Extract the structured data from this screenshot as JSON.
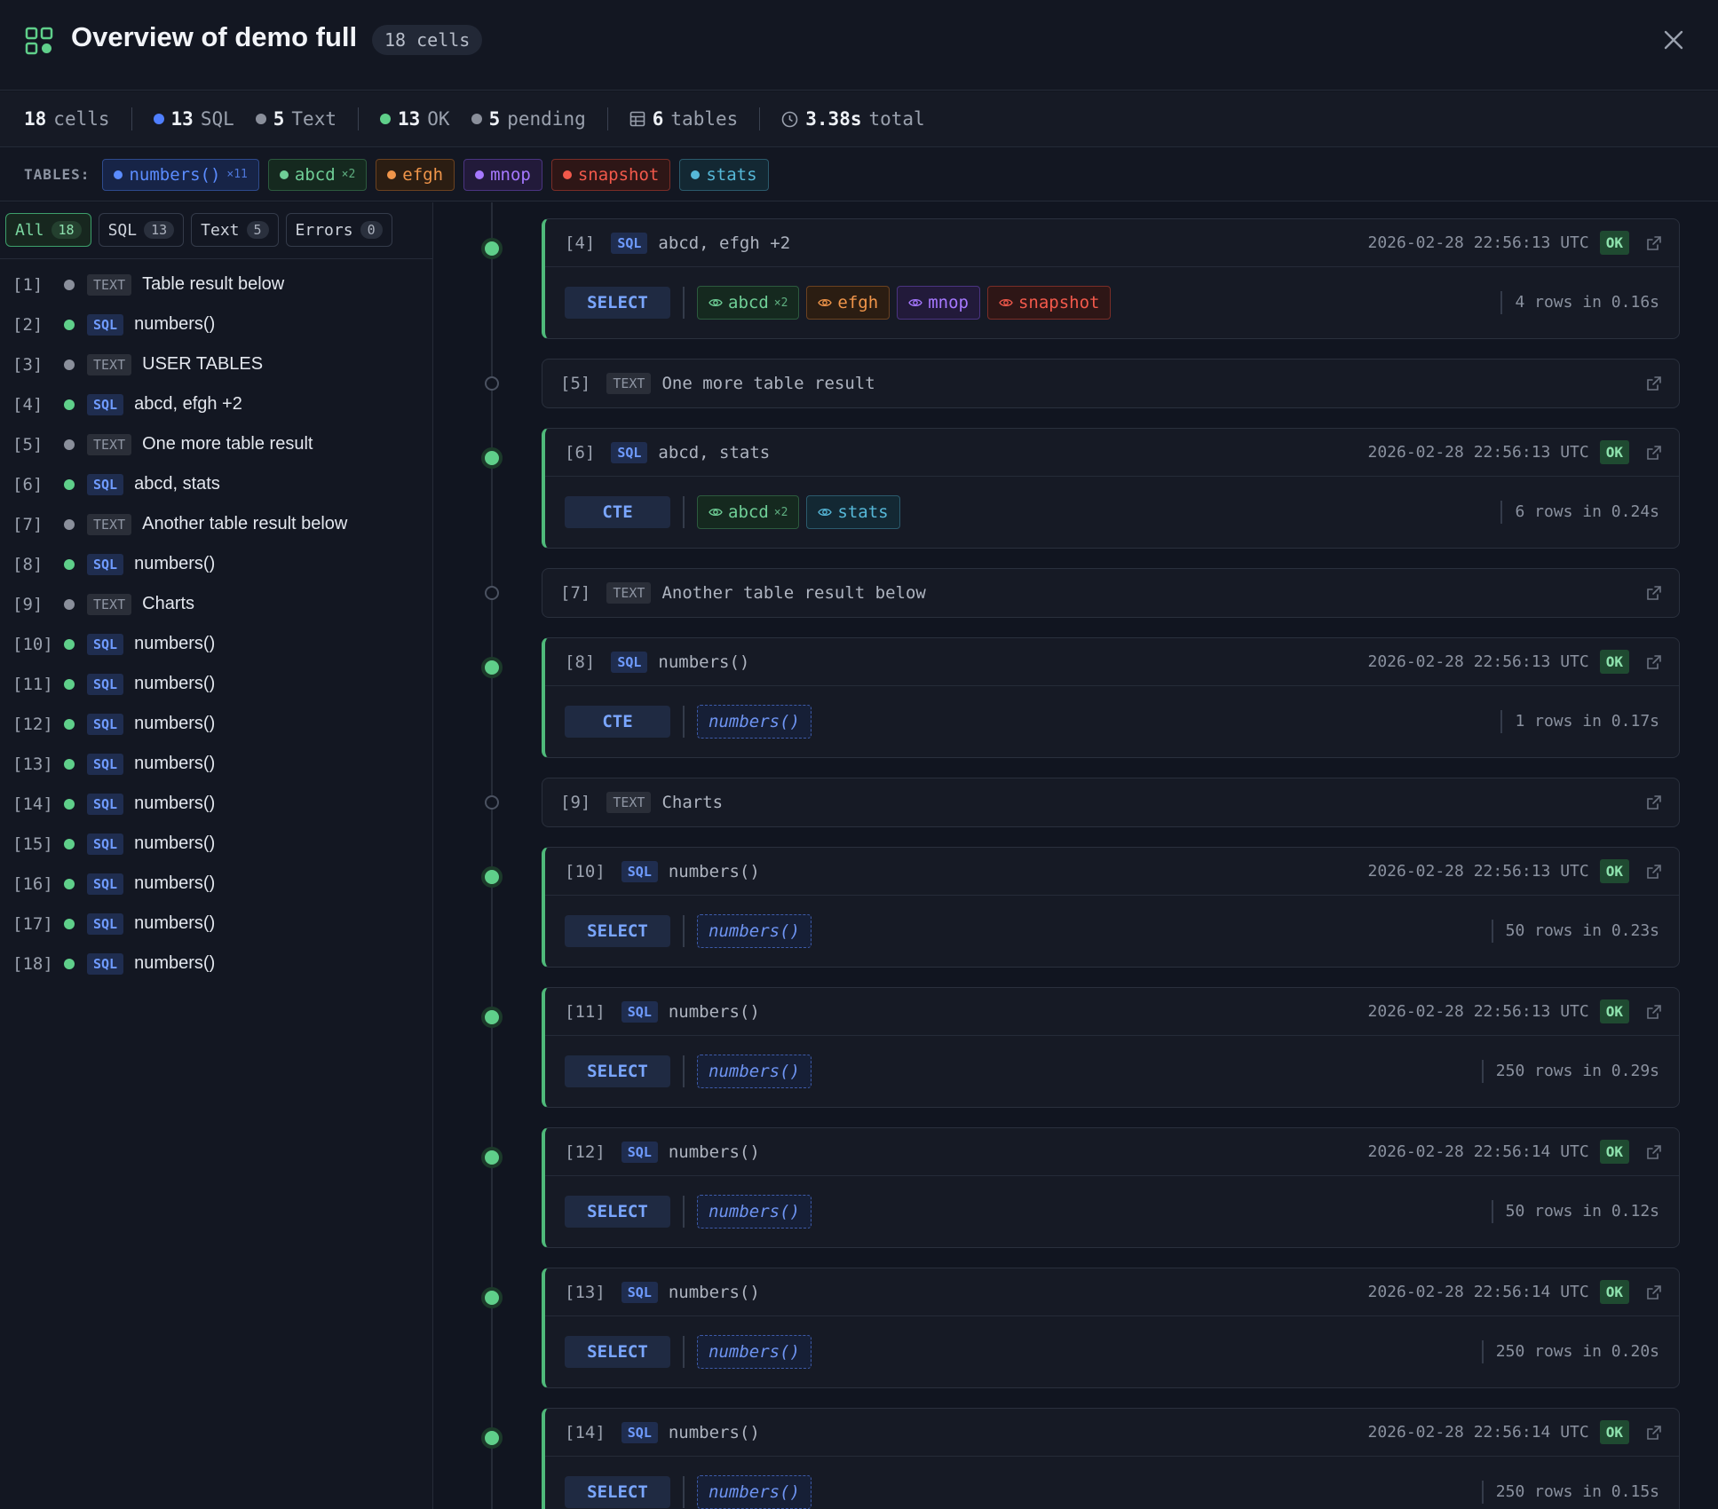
{
  "header": {
    "title": "Overview of demo full",
    "cells_pill": "18 cells"
  },
  "stats": {
    "cells_n": "18",
    "cells_lbl": "cells",
    "sql_n": "13",
    "sql_lbl": "SQL",
    "text_n": "5",
    "text_lbl": "Text",
    "ok_n": "13",
    "ok_lbl": "OK",
    "pending_n": "5",
    "pending_lbl": "pending",
    "tables_n": "6",
    "tables_lbl": "tables",
    "total_n": "3.38s",
    "total_lbl": "total"
  },
  "tables_label": "TABLES:",
  "tables": [
    {
      "name": "numbers()",
      "count": "×11",
      "color": "#5b8cff",
      "bg": "#172447",
      "border": "#2e4a8c"
    },
    {
      "name": "abcd",
      "count": "×2",
      "color": "#6fcf97",
      "bg": "#15291f",
      "border": "#2c5a3e"
    },
    {
      "name": "efgh",
      "count": "",
      "color": "#f0954a",
      "bg": "#2b1d12",
      "border": "#6b4220"
    },
    {
      "name": "mnop",
      "count": "",
      "color": "#a678ff",
      "bg": "#221a3a",
      "border": "#4a3480"
    },
    {
      "name": "snapshot",
      "count": "",
      "color": "#f2594b",
      "bg": "#2e1616",
      "border": "#7a2d27"
    },
    {
      "name": "stats",
      "count": "",
      "color": "#56b8d8",
      "bg": "#132833",
      "border": "#2b5a6c"
    }
  ],
  "filter_tabs": [
    {
      "label": "All",
      "n": "18"
    },
    {
      "label": "SQL",
      "n": "13"
    },
    {
      "label": "Text",
      "n": "5"
    },
    {
      "label": "Errors",
      "n": "0"
    }
  ],
  "sidebar_items": [
    {
      "idx": "[1]",
      "type": "TEXT",
      "name": "Table result below"
    },
    {
      "idx": "[2]",
      "type": "SQL",
      "name": "numbers()"
    },
    {
      "idx": "[3]",
      "type": "TEXT",
      "name": "USER TABLES"
    },
    {
      "idx": "[4]",
      "type": "SQL",
      "name": "abcd, efgh +2"
    },
    {
      "idx": "[5]",
      "type": "TEXT",
      "name": "One more table result"
    },
    {
      "idx": "[6]",
      "type": "SQL",
      "name": "abcd, stats"
    },
    {
      "idx": "[7]",
      "type": "TEXT",
      "name": "Another table result below"
    },
    {
      "idx": "[8]",
      "type": "SQL",
      "name": "numbers()"
    },
    {
      "idx": "[9]",
      "type": "TEXT",
      "name": "Charts"
    },
    {
      "idx": "[10]",
      "type": "SQL",
      "name": "numbers()"
    },
    {
      "idx": "[11]",
      "type": "SQL",
      "name": "numbers()"
    },
    {
      "idx": "[12]",
      "type": "SQL",
      "name": "numbers()"
    },
    {
      "idx": "[13]",
      "type": "SQL",
      "name": "numbers()"
    },
    {
      "idx": "[14]",
      "type": "SQL",
      "name": "numbers()"
    },
    {
      "idx": "[15]",
      "type": "SQL",
      "name": "numbers()"
    },
    {
      "idx": "[16]",
      "type": "SQL",
      "name": "numbers()"
    },
    {
      "idx": "[17]",
      "type": "SQL",
      "name": "numbers()"
    },
    {
      "idx": "[18]",
      "type": "SQL",
      "name": "numbers()"
    }
  ],
  "cards": [
    {
      "idx": "[4]",
      "type": "SQL",
      "name": "abcd, efgh +2",
      "ts": "2026-02-28 22:56:13 UTC",
      "status": "OK",
      "kw": "SELECT",
      "chips": [
        {
          "t": "abcd",
          "c": "×2",
          "k": "abcd"
        },
        {
          "t": "efgh",
          "c": "",
          "k": "efgh"
        },
        {
          "t": "mnop",
          "c": "",
          "k": "mnop"
        },
        {
          "t": "snapshot",
          "c": "",
          "k": "snapshot"
        }
      ],
      "rows": "4 rows in 0.16s"
    },
    {
      "idx": "[5]",
      "type": "TEXT",
      "name": "One more table result"
    },
    {
      "idx": "[6]",
      "type": "SQL",
      "name": "abcd, stats",
      "ts": "2026-02-28 22:56:13 UTC",
      "status": "OK",
      "kw": "CTE",
      "chips": [
        {
          "t": "abcd",
          "c": "×2",
          "k": "abcd"
        },
        {
          "t": "stats",
          "c": "",
          "k": "stats"
        }
      ],
      "rows": "6 rows in 0.24s"
    },
    {
      "idx": "[7]",
      "type": "TEXT",
      "name": "Another table result below"
    },
    {
      "idx": "[8]",
      "type": "SQL",
      "name": "numbers()",
      "ts": "2026-02-28 22:56:13 UTC",
      "status": "OK",
      "kw": "CTE",
      "chips": [
        {
          "t": "numbers()",
          "c": "",
          "k": "numbers"
        }
      ],
      "rows": "1 rows in 0.17s"
    },
    {
      "idx": "[9]",
      "type": "TEXT",
      "name": "Charts"
    },
    {
      "idx": "[10]",
      "type": "SQL",
      "name": "numbers()",
      "ts": "2026-02-28 22:56:13 UTC",
      "status": "OK",
      "kw": "SELECT",
      "chips": [
        {
          "t": "numbers()",
          "c": "",
          "k": "numbers"
        }
      ],
      "rows": "50 rows in 0.23s"
    },
    {
      "idx": "[11]",
      "type": "SQL",
      "name": "numbers()",
      "ts": "2026-02-28 22:56:13 UTC",
      "status": "OK",
      "kw": "SELECT",
      "chips": [
        {
          "t": "numbers()",
          "c": "",
          "k": "numbers"
        }
      ],
      "rows": "250 rows in 0.29s"
    },
    {
      "idx": "[12]",
      "type": "SQL",
      "name": "numbers()",
      "ts": "2026-02-28 22:56:14 UTC",
      "status": "OK",
      "kw": "SELECT",
      "chips": [
        {
          "t": "numbers()",
          "c": "",
          "k": "numbers"
        }
      ],
      "rows": "50 rows in 0.12s"
    },
    {
      "idx": "[13]",
      "type": "SQL",
      "name": "numbers()",
      "ts": "2026-02-28 22:56:14 UTC",
      "status": "OK",
      "kw": "SELECT",
      "chips": [
        {
          "t": "numbers()",
          "c": "",
          "k": "numbers"
        }
      ],
      "rows": "250 rows in 0.20s"
    },
    {
      "idx": "[14]",
      "type": "SQL",
      "name": "numbers()",
      "ts": "2026-02-28 22:56:14 UTC",
      "status": "OK",
      "kw": "SELECT",
      "chips": [
        {
          "t": "numbers()",
          "c": "",
          "k": "numbers"
        }
      ],
      "rows": "250 rows in 0.15s"
    }
  ],
  "colors": {
    "sql_dot": "#4f7fff",
    "text_dot": "#8a8f9b",
    "ok_dot": "#5fcf8a",
    "pending_dot": "#8a8f9b",
    "accent": "#4fb97a"
  }
}
